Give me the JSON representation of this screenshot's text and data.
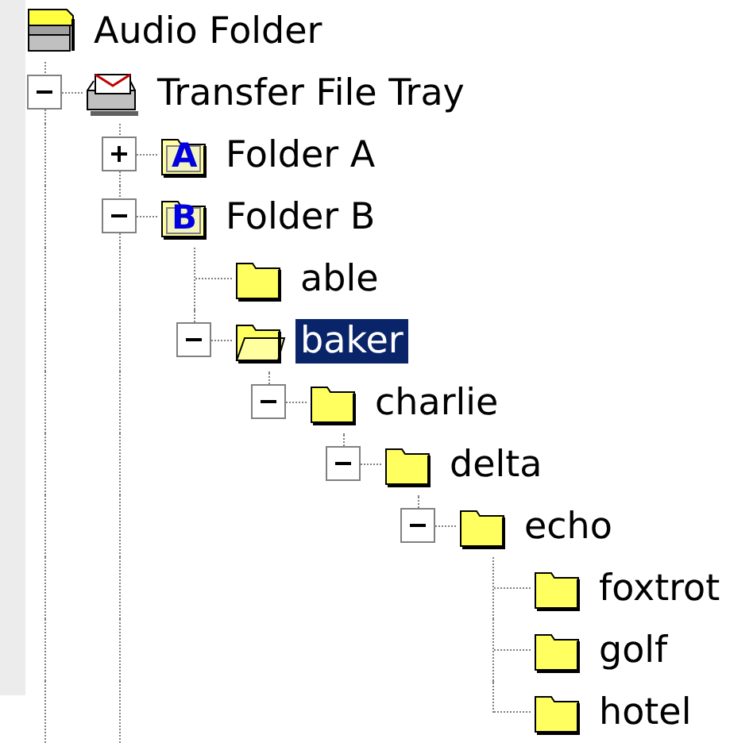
{
  "tree": [
    {
      "label": "Audio Folder",
      "kind": "audio",
      "selected": false,
      "more_below": true,
      "children": [
        {
          "label": "Transfer File Tray",
          "kind": "tray",
          "selected": false,
          "expanded": true,
          "more_below": true,
          "children": [
            {
              "label": "Folder A",
              "kind": "lettered",
              "badge": "A",
              "selected": false,
              "expanded": false
            },
            {
              "label": "Folder B",
              "kind": "lettered",
              "badge": "B",
              "selected": false,
              "expanded": true,
              "children": [
                {
                  "label": "able",
                  "kind": "folder",
                  "selected": false
                },
                {
                  "label": "baker",
                  "kind": "folder",
                  "selected": true,
                  "expanded": true,
                  "children": [
                    {
                      "label": "charlie",
                      "kind": "folder",
                      "selected": false,
                      "expanded": true,
                      "children": [
                        {
                          "label": "delta",
                          "kind": "folder",
                          "selected": false,
                          "expanded": true,
                          "children": [
                            {
                              "label": "echo",
                              "kind": "folder",
                              "selected": false,
                              "expanded": true,
                              "children": [
                                {
                                  "label": "foxtrot",
                                  "kind": "folder",
                                  "selected": false
                                },
                                {
                                  "label": "golf",
                                  "kind": "folder",
                                  "selected": false
                                },
                                {
                                  "label": "hotel",
                                  "kind": "folder",
                                  "selected": false
                                }
                              ]
                            }
                          ]
                        }
                      ]
                    }
                  ]
                }
              ]
            }
          ]
        }
      ]
    }
  ]
}
